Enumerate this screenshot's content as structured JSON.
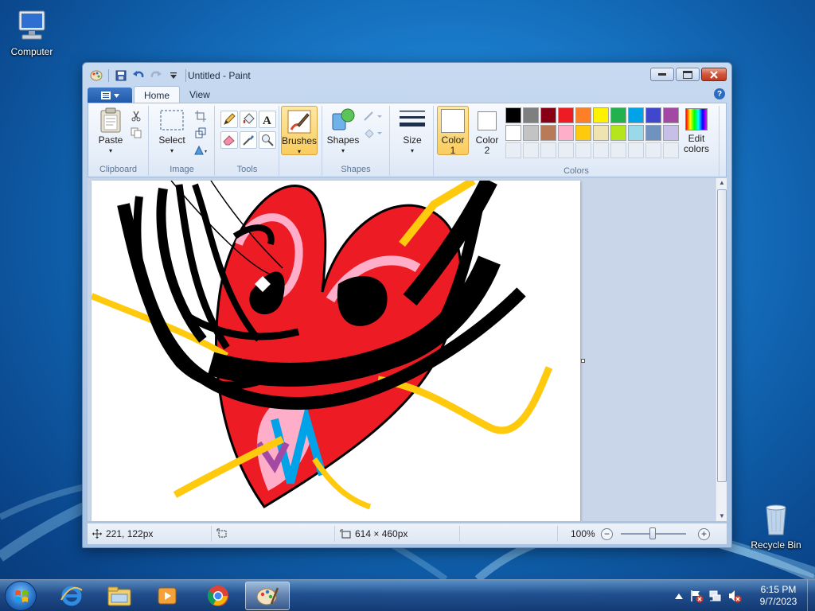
{
  "desktop": {
    "icons": [
      {
        "label": "Computer",
        "icon": "computer-icon"
      },
      {
        "label": "Recycle Bin",
        "icon": "recycle-bin-icon"
      }
    ]
  },
  "window": {
    "title": "Untitled - Paint",
    "tabs": [
      {
        "label": "Home",
        "active": true
      },
      {
        "label": "View",
        "active": false
      }
    ],
    "help": "?"
  },
  "ribbon": {
    "groups": {
      "clipboard": "Clipboard",
      "image": "Image",
      "tools": "Tools",
      "shapes": "Shapes",
      "colors": "Colors"
    },
    "paste": "Paste",
    "select": "Select",
    "brushes": "Brushes",
    "shapes": "Shapes",
    "size": "Size",
    "color1": {
      "line1": "Color",
      "line2": "1"
    },
    "color2": {
      "line1": "Color",
      "line2": "2"
    },
    "edit_colors": {
      "line1": "Edit",
      "line2": "colors"
    },
    "palette": [
      "#000000",
      "#7f7f7f",
      "#880015",
      "#ed1c24",
      "#ff7f27",
      "#fff200",
      "#22b14c",
      "#00a2e8",
      "#3f48cc",
      "#a349a4",
      "#ffffff",
      "#c3c3c3",
      "#b97a57",
      "#ffaec9",
      "#ffc90e",
      "#efe4b0",
      "#b5e61d",
      "#99d9ea",
      "#7092be",
      "#c8bfe7"
    ]
  },
  "status": {
    "cursor_pos": "221, 122px",
    "canvas_size": "614 × 460px",
    "zoom": "100%",
    "zoom_out": "−",
    "zoom_in": "+"
  },
  "taskbar": {
    "apps": [
      "internet-explorer-icon",
      "file-explorer-icon",
      "media-player-icon",
      "chrome-icon",
      "paint-icon"
    ],
    "clock_time": "6:15 PM",
    "clock_date": "9/7/2023"
  },
  "colors": {
    "accent": "#1f58a8",
    "active_highlight": "#f9cc5e"
  }
}
